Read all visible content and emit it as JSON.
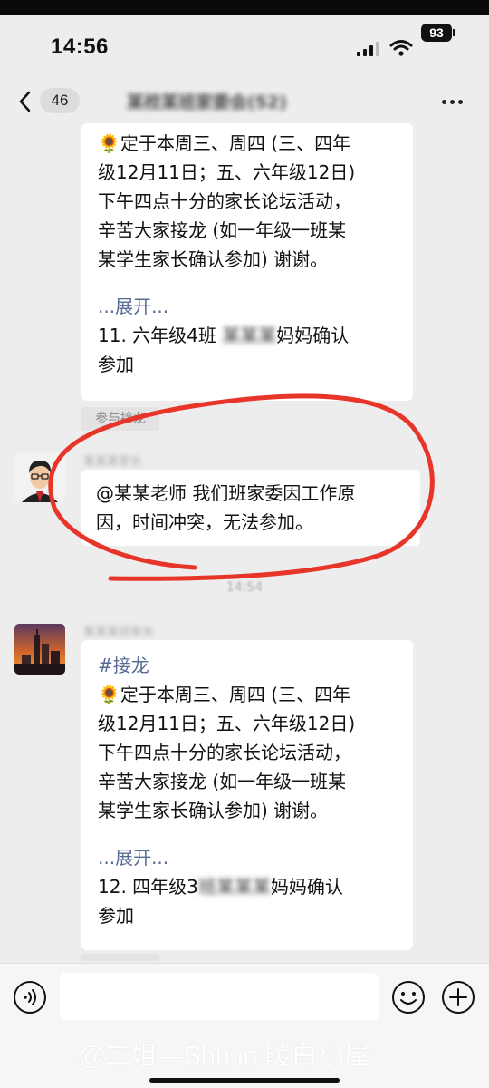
{
  "status_bar": {
    "time": "14:56",
    "battery": "93"
  },
  "navbar": {
    "unread_count": "46",
    "title": "某校某班家委会(52)"
  },
  "messages": [
    {
      "lines": "定于本周三、周四 (三、四年\n级12月11日；五、六年级12日)\n下午四点十分的家长论坛活动，\n辛苦大家接龙 (如一年级一班某\n某学生家长确认参加) 谢谢。",
      "expand": "...展开...",
      "entry_prefix": "11. 六年级4班 ",
      "entry_blurred": "某某某",
      "entry_suffix": "妈妈确认\n参加"
    },
    {
      "sender_name": "某某某家长",
      "mention": "@某某老师",
      "text": " 我们班家委因工作原\n因，时间冲突，无法参加。"
    },
    {
      "sender_name": "某某某班家长",
      "topic": "#接龙",
      "lines": "定于本周三、周四 (三、四年\n级12月11日；五、六年级12日)\n下午四点十分的家长论坛活动，\n辛苦大家接龙 (如一年级一班某\n某学生家长确认参加) 谢谢。",
      "expand": "...展开...",
      "entry_prefix": "12. 四年级3",
      "entry_blurred": "班某某某",
      "entry_suffix": "妈妈确认\n参加"
    }
  ],
  "join_tag": "参与接龙",
  "timestamp": "14:54",
  "input": {
    "value": ""
  },
  "watermark": "@二姐—Shu in 暖白小屋",
  "icons": [
    "back-icon",
    "more-icon",
    "voice-icon",
    "emoji-icon",
    "plus-icon",
    "signal-icon",
    "wifi-icon",
    "sunflower-icon"
  ],
  "colors": {
    "background": "#ededed",
    "link": "#576b95",
    "annotation": "#e8352a"
  }
}
